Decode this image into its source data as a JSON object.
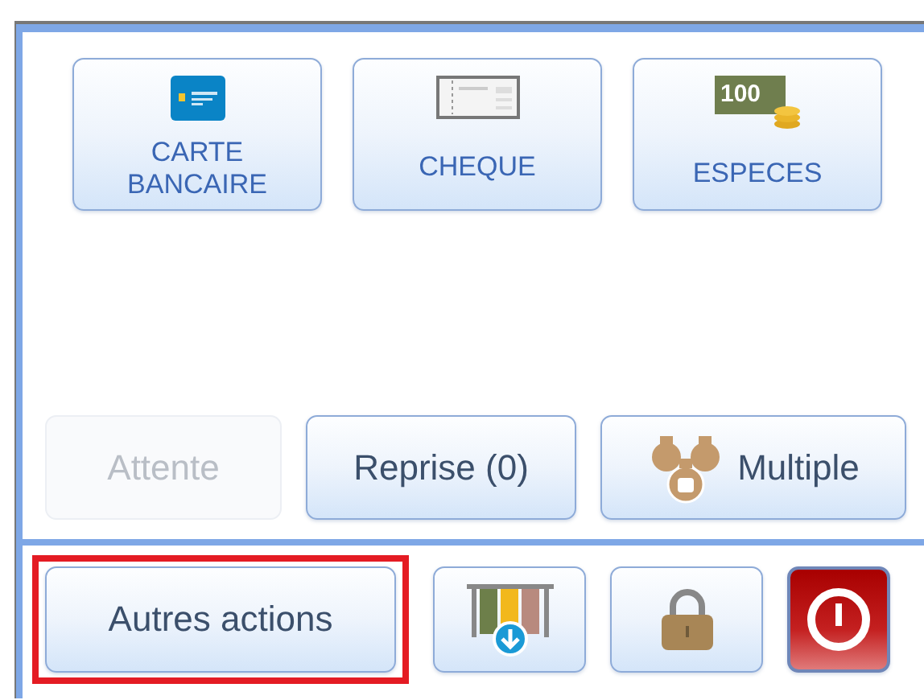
{
  "payment_methods": [
    {
      "label": "CARTE\nBANCAIRE",
      "kind": "card"
    },
    {
      "label": "CHEQUE",
      "kind": "cheque"
    },
    {
      "label": "ESPECES",
      "kind": "cash",
      "icon_text": "100"
    }
  ],
  "actions": [
    {
      "label": "Attente",
      "disabled": true
    },
    {
      "label": "Reprise (0)",
      "disabled": false
    },
    {
      "label": "Multiple",
      "disabled": false,
      "kind": "bags"
    }
  ],
  "toolbar": {
    "other_actions": {
      "label": "Autres actions",
      "highlighted": true
    },
    "icon_buttons": [
      {
        "kind": "download"
      },
      {
        "kind": "lock"
      },
      {
        "kind": "power"
      }
    ]
  }
}
